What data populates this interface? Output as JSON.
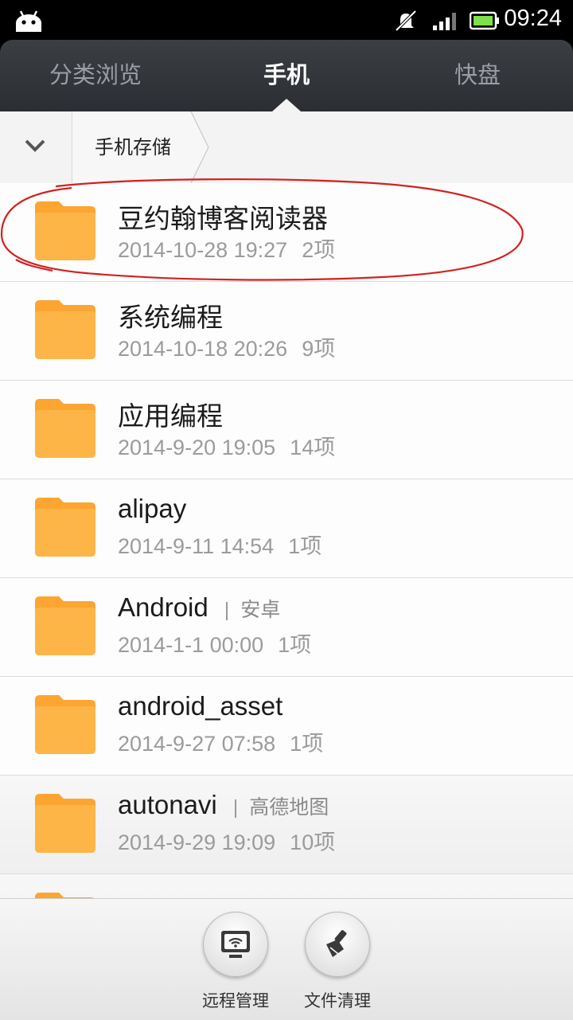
{
  "status_bar": {
    "time": "09:24",
    "icons": [
      "android-icon",
      "mute-icon",
      "signal-icon",
      "battery-icon"
    ]
  },
  "tabs": [
    {
      "label": "分类浏览",
      "active": false
    },
    {
      "label": "手机",
      "active": true
    },
    {
      "label": "快盘",
      "active": false
    }
  ],
  "breadcrumb": {
    "toggle_icon": "chevron-down-icon",
    "current": "手机存储"
  },
  "files": [
    {
      "name": "豆约翰博客阅读器",
      "alias": "",
      "date": "2014-10-28 19:27",
      "count": "2项"
    },
    {
      "name": "系统编程",
      "alias": "",
      "date": "2014-10-18 20:26",
      "count": "9项"
    },
    {
      "name": "应用编程",
      "alias": "",
      "date": "2014-9-20 19:05",
      "count": "14项"
    },
    {
      "name": "alipay",
      "alias": "",
      "date": "2014-9-11 14:54",
      "count": "1项"
    },
    {
      "name": "Android",
      "alias": "安卓",
      "date": "2014-1-1 00:00",
      "count": "1项"
    },
    {
      "name": "android_asset",
      "alias": "",
      "date": "2014-9-27 07:58",
      "count": "1项"
    },
    {
      "name": "autonavi",
      "alias": "高德地图",
      "date": "2014-9-29 19:09",
      "count": "10项"
    }
  ],
  "bottom_actions": [
    {
      "label": "远程管理",
      "icon": "remote-manage-icon"
    },
    {
      "label": "文件清理",
      "icon": "broom-icon"
    }
  ],
  "colors": {
    "folder": "#fdb13f",
    "annotation": "#d42020",
    "tabbar": "#33363b"
  }
}
